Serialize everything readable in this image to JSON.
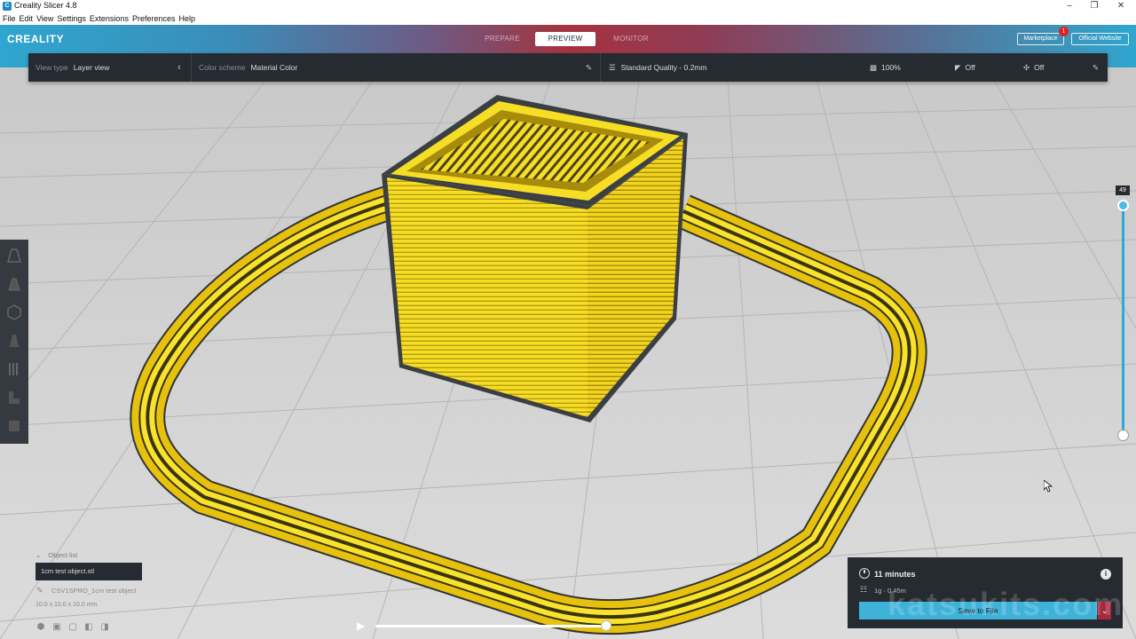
{
  "window": {
    "title": "Creality Slicer 4.8",
    "icon_letter": "C"
  },
  "menu": [
    "File",
    "Edit",
    "View",
    "Settings",
    "Extensions",
    "Preferences",
    "Help"
  ],
  "header": {
    "logo": "CREALITY",
    "tabs": [
      {
        "label": "PREPARE",
        "active": false
      },
      {
        "label": "PREVIEW",
        "active": true
      },
      {
        "label": "MONITOR",
        "active": false
      }
    ],
    "marketplace": "Marketplace",
    "marketplace_badge": "1",
    "official_website": "Official Website"
  },
  "toolbar": {
    "view_type_label": "View type",
    "view_type_value": "Layer view",
    "color_scheme_label": "Color scheme",
    "color_scheme_value": "Material Color",
    "profile": "Standard Quality - 0.2mm",
    "infill": "100%",
    "support": "Off",
    "adhesion": "Off"
  },
  "layer_slider": {
    "current": "49",
    "fraction": 1.0
  },
  "object_list": {
    "heading": "Object list",
    "selected_file": "1cm test object.stl",
    "object_name": "CSV1SPRO_1cm test object",
    "dimensions": "10.0 x 10.0 x 10.0 mm"
  },
  "print_info": {
    "time": "11 minutes",
    "material": "1g · 0.45m",
    "save_label": "Save to File",
    "info_icon": "i"
  },
  "watermark": "katsukits.com",
  "colors": {
    "accent": "#3fb2da",
    "dropdown": "#a8283d",
    "filament": "#f6de25",
    "panel": "#262b31"
  }
}
